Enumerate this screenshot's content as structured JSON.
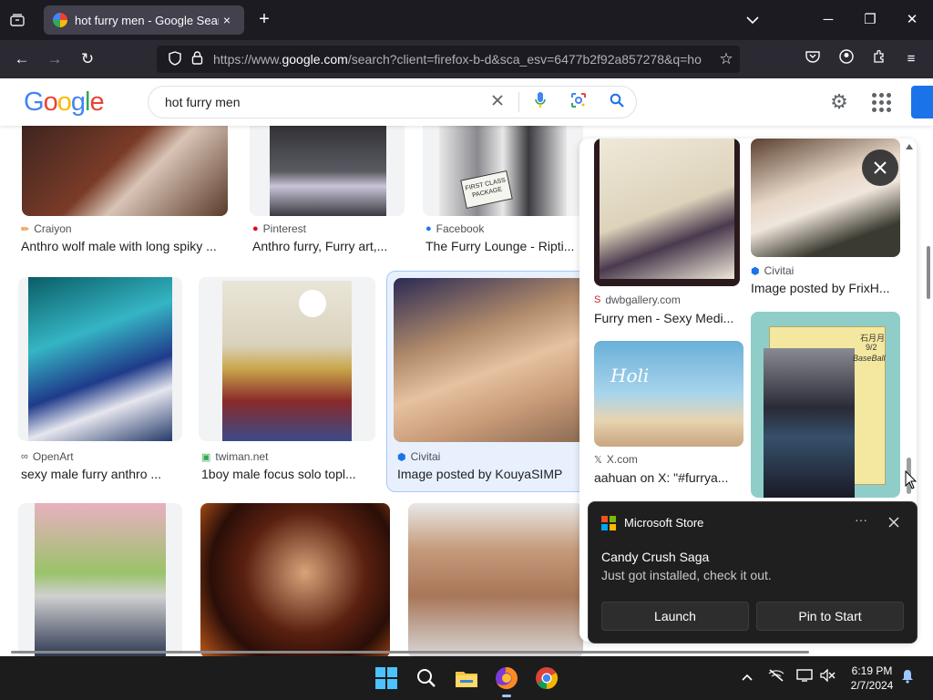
{
  "browser": {
    "tab_title": "hot furry men - Google Search",
    "url_prefix": "https://www.",
    "url_domain": "google.com",
    "url_rest": "/search?client=firefox-b-d&sca_esv=6477b2f92a857278&q=ho",
    "icons": {
      "tab_list": "tab-list-icon",
      "close_tab": "×",
      "new_tab": "+",
      "minimize": "─",
      "maximize": "❐",
      "close": "✕",
      "back": "←",
      "forward": "→",
      "reload": "↻",
      "shield": "⛉",
      "lock": "🔒",
      "star": "☆",
      "pocket": "◫",
      "account": "◉",
      "extensions": "⧉",
      "menu": "≡"
    }
  },
  "google": {
    "logo": [
      "G",
      "o",
      "o",
      "g",
      "l",
      "e"
    ],
    "logo_colors": [
      "#4285f4",
      "#ea4335",
      "#fbbc05",
      "#4285f4",
      "#34a853",
      "#ea4335"
    ],
    "query": "hot furry men"
  },
  "results": [
    {
      "source": "Craiyon",
      "source_icon": "✏",
      "source_color": "#e8710a",
      "title": "Anthro wolf male with long spiky ..."
    },
    {
      "source": "Pinterest",
      "source_icon": "●",
      "source_color": "#e60023",
      "title": "Anthro furry, Furry art,..."
    },
    {
      "source": "Facebook",
      "source_icon": "●",
      "source_color": "#1877f2",
      "title": "The Furry Lounge - Ripti..."
    },
    {
      "source": "OpenArt",
      "source_icon": "∞",
      "source_color": "#202124",
      "title": "sexy male furry anthro ..."
    },
    {
      "source": "twiman.net",
      "source_icon": "▣",
      "source_color": "#34a853",
      "title": "1boy male focus solo topl..."
    },
    {
      "source": "Civitai",
      "source_icon": "⬢",
      "source_color": "#1a73e8",
      "title": "Image posted by KouyaSIMP"
    },
    {
      "source": "",
      "source_icon": "",
      "source_color": "#000",
      "title": ""
    },
    {
      "source": "",
      "source_icon": "",
      "source_color": "#000",
      "title": ""
    },
    {
      "source": "",
      "source_icon": "",
      "source_color": "#000",
      "title": ""
    }
  ],
  "panel": [
    {
      "source": "dwbgallery.com",
      "source_icon": "S",
      "source_color": "#c5221f",
      "title": "Furry men - Sexy Medi..."
    },
    {
      "source": "Civitai",
      "source_icon": "⬢",
      "source_color": "#1a73e8",
      "title": "Image posted by FrixH..."
    },
    {
      "source": "X.com",
      "source_icon": "𝕏",
      "source_color": "#000",
      "title": "aahuan on X: \"#furrya..."
    },
    {
      "source": "",
      "source_icon": "",
      "source_color": "#000",
      "title": ""
    }
  ],
  "image_text": {
    "holiday": "Holi",
    "sign": "FIRST CLASS PACKAGE",
    "baseball_jp": "石月月",
    "baseball_date": "9/2",
    "baseball_word": "BaseBall"
  },
  "toast": {
    "app_name": "Microsoft Store",
    "title": "Candy Crush Saga",
    "body": "Just got installed, check it out.",
    "launch": "Launch",
    "pin": "Pin to Start"
  },
  "taskbar": {
    "time": "6:19 PM",
    "date": "2/7/2024"
  },
  "colors": {
    "accent_blue": "#1a73e8",
    "selected_bg": "#e8f0fe"
  }
}
